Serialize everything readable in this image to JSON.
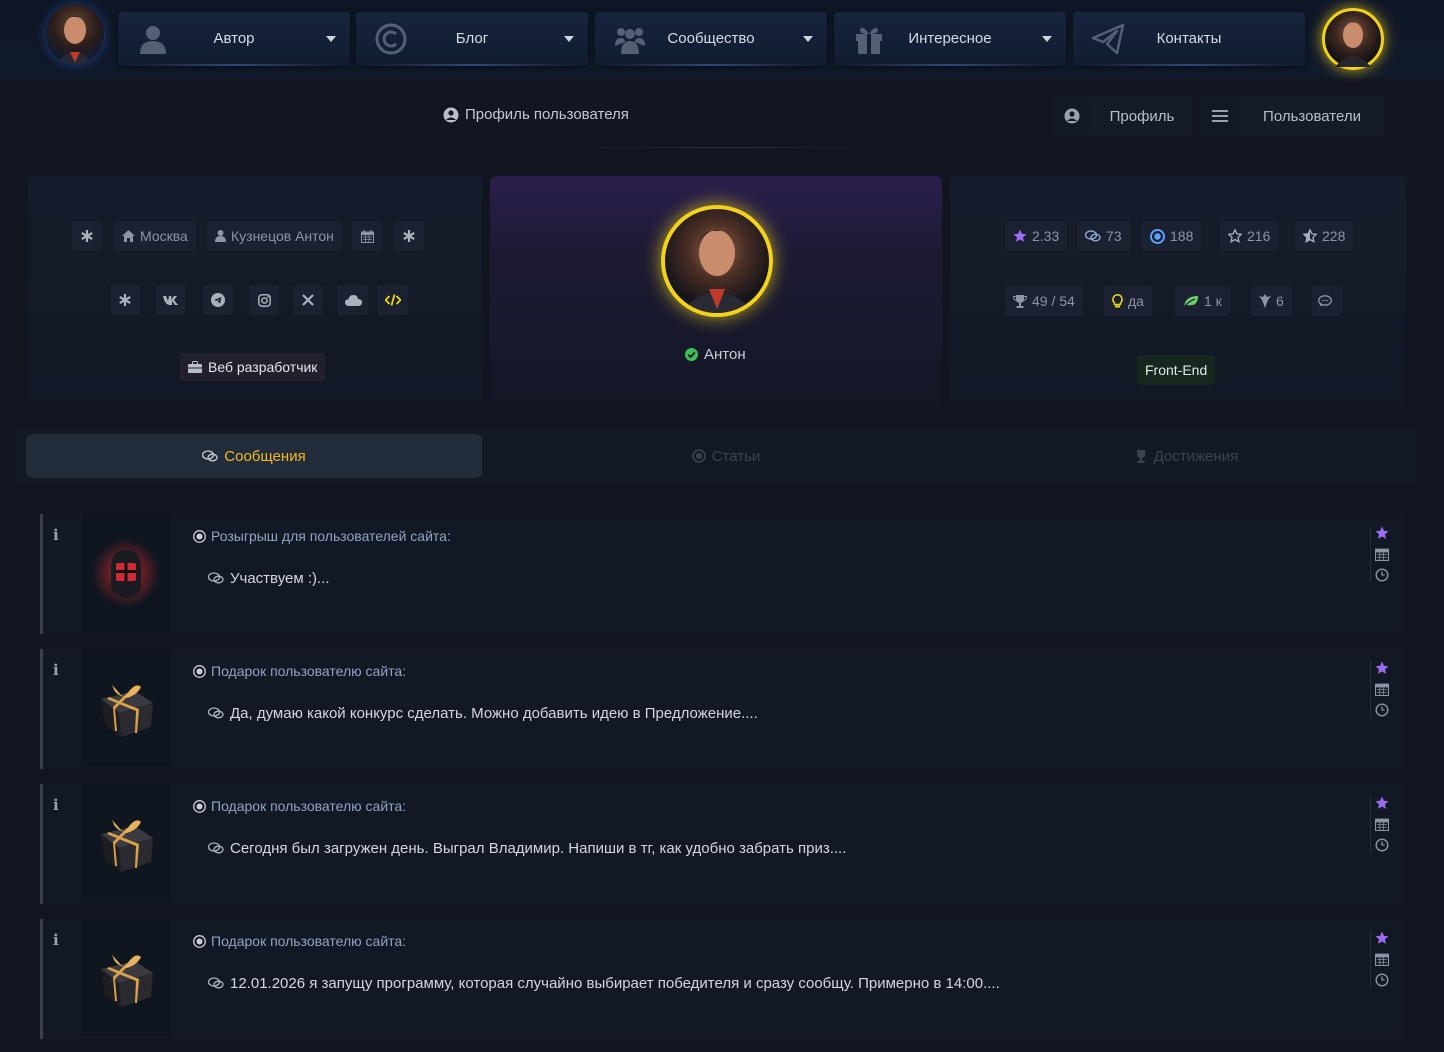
{
  "nav": {
    "items": [
      {
        "label": "Автор",
        "icon": "user-icon"
      },
      {
        "label": "Блог",
        "icon": "copyright-icon"
      },
      {
        "label": "Сообщество",
        "icon": "users-icon"
      },
      {
        "label": "Интересное",
        "icon": "gift-icon"
      },
      {
        "label": "Контакты",
        "icon": "paper-plane-icon"
      }
    ]
  },
  "header": {
    "title": "Профиль пользователя",
    "profile_label": "Профиль",
    "users_label": "Пользователи"
  },
  "profile": {
    "city": "Москва",
    "full_name": "Кузнецов Антон",
    "role": "Веб разработчик",
    "username": "Антон",
    "skill": "Front-End",
    "stats_row1": [
      "2.33",
      "73",
      "188",
      "216",
      "228"
    ],
    "stats_row2": [
      "49 / 54",
      "да",
      "1 к",
      "6",
      ""
    ]
  },
  "tabs": [
    {
      "label": "Сообщения",
      "active": true
    },
    {
      "label": "Статьи",
      "active": false
    },
    {
      "label": "Достижения",
      "active": false
    }
  ],
  "posts": [
    {
      "subject": "Розыгрыш для пользователей сайта:",
      "text": "Участвуем :)..."
    },
    {
      "subject": "Подарок пользователю сайта:",
      "text": "Да, думаю какой конкурс сделать. Можно добавить идею в Предложение...."
    },
    {
      "subject": "Подарок пользователю сайта:",
      "text": "Сегодня был загружен день. Выграл Владимир. Напиши в тг, как удобно забрать приз...."
    },
    {
      "subject": "Подарок пользователю сайта:",
      "text": "12.01.2026 я запущу программу, которая случайно выбирает победителя и сразу сообщу. Примерно в 14:00...."
    }
  ],
  "colors": {
    "accent_yellow": "#f2d21b",
    "active_tab_text": "#f2b824",
    "star_purple": "#9b6cf0"
  }
}
